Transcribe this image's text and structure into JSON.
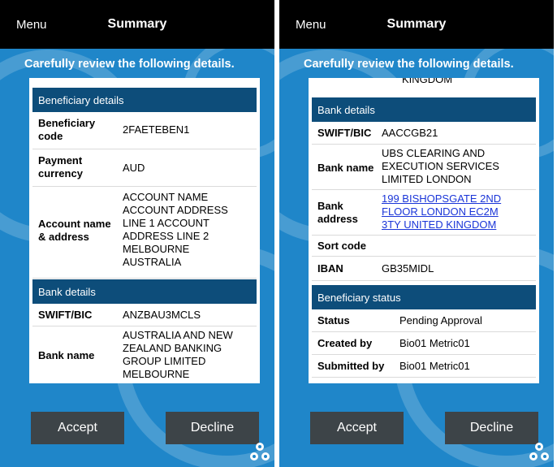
{
  "screens": [
    {
      "menu_label": "Menu",
      "title": "Summary",
      "instruction": "Carefully review the following details.",
      "beneficiary_header": "Beneficiary details",
      "beneficiary_code_label_1": "Beneficiary",
      "beneficiary_code_label_2": "code",
      "beneficiary_code": "2FAETEBEN1",
      "payment_currency_label_1": "Payment",
      "payment_currency_label_2": "currency",
      "payment_currency": "AUD",
      "account_label_1": "Account name",
      "account_label_2": "& address",
      "account_lines": [
        "ACCOUNT NAME",
        "ACCOUNT ADDRESS",
        "LINE 1 ACCOUNT",
        "ADDRESS LINE 2",
        "MELBOURNE",
        "AUSTRALIA"
      ],
      "bank_header": "Bank details",
      "swift_label": "SWIFT/BIC",
      "swift": "ANZBAU3MCLS",
      "bank_name_label": "Bank name",
      "bank_name_lines": [
        "AUSTRALIA AND NEW",
        "ZEALAND BANKING",
        "GROUP LIMITED",
        "MELBOURNE"
      ],
      "accept_label": "Accept",
      "decline_label": "Decline"
    },
    {
      "menu_label": "Menu",
      "title": "Summary",
      "instruction": "Carefully review the following details.",
      "cut_off_text": "KINGDOM",
      "bank_header": "Bank details",
      "swift_label": "SWIFT/BIC",
      "swift": "AACCGB21",
      "bank_name_label": "Bank name",
      "bank_name_lines": [
        "UBS CLEARING AND",
        "EXECUTION SERVICES",
        "LIMITED LONDON"
      ],
      "bank_address_label_1": "Bank",
      "bank_address_label_2": "address",
      "bank_address_lines": [
        "199 BISHOPSGATE 2ND",
        "FLOOR LONDON EC2M",
        "3TY UNITED KINGDOM"
      ],
      "sort_code_label": "Sort code",
      "sort_code": "",
      "iban_label": "IBAN",
      "iban": "GB35MIDL",
      "status_header": "Beneficiary status",
      "status_label": "Status",
      "status": "Pending Approval",
      "created_label": "Created by",
      "created_by": "Bio01 Metric01",
      "submitted_label": "Submitted by",
      "submitted_by": "Bio01 Metric01",
      "accept_label": "Accept",
      "decline_label": "Decline"
    }
  ]
}
